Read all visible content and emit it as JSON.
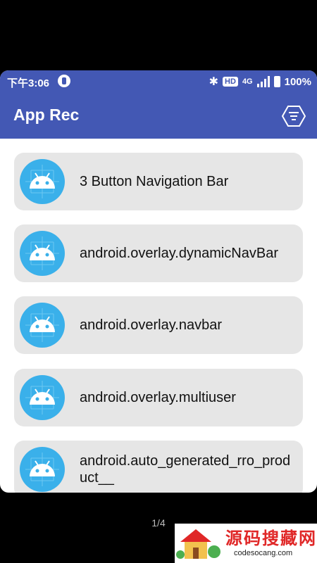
{
  "status_bar": {
    "time": "下午3:06",
    "hd": "HD",
    "network": "4G",
    "battery": "100%"
  },
  "app_bar": {
    "title": "App Rec",
    "filter_icon": "filter-icon"
  },
  "list": {
    "items": [
      {
        "label": "3 Button Navigation Bar",
        "icon": "android-icon"
      },
      {
        "label": "android.overlay.dynamicNavBar",
        "icon": "android-icon"
      },
      {
        "label": "android.overlay.navbar",
        "icon": "android-icon"
      },
      {
        "label": "android.overlay.multiuser",
        "icon": "android-icon"
      },
      {
        "label": "android.auto_generated_rro_product__",
        "icon": "android-icon"
      }
    ]
  },
  "pager": {
    "text": "1/4"
  },
  "watermark": {
    "main": "源码搜藏网",
    "sub": "codesocang.com"
  },
  "colors": {
    "accent": "#4358b4",
    "icon_bg": "#3ab0ea",
    "card_bg": "#e6e6e6"
  }
}
